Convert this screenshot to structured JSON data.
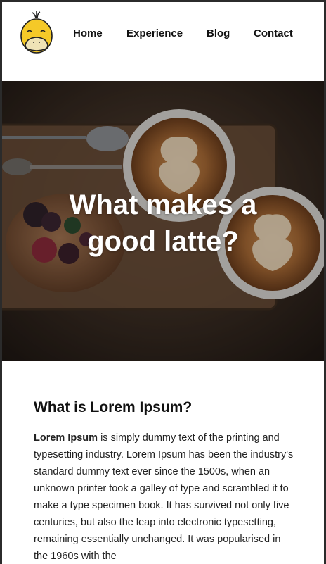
{
  "nav": {
    "items": [
      {
        "label": "Home"
      },
      {
        "label": "Experience"
      },
      {
        "label": "Blog"
      },
      {
        "label": "Contact"
      }
    ]
  },
  "logo": {
    "icon": "yellow-duck-mascot-icon"
  },
  "hero": {
    "title": "What makes a good latte?"
  },
  "article": {
    "heading": "What is Lorem Ipsum?",
    "lead_bold": "Lorem Ipsum",
    "body": " is simply dummy text of the printing and typesetting industry. Lorem Ipsum has been the industry's standard dummy text ever since the 1500s, when an unknown printer took a galley of type and scrambled it to make a type specimen book. It has survived not only five centuries, but also the leap into electronic typesetting, remaining essentially unchanged. It was popularised in the 1960s with the"
  },
  "colors": {
    "background": "#ffffff",
    "frame": "#2b2b2b",
    "text": "#111111",
    "hero_text": "#ffffff",
    "duck_yellow": "#f5c928"
  }
}
